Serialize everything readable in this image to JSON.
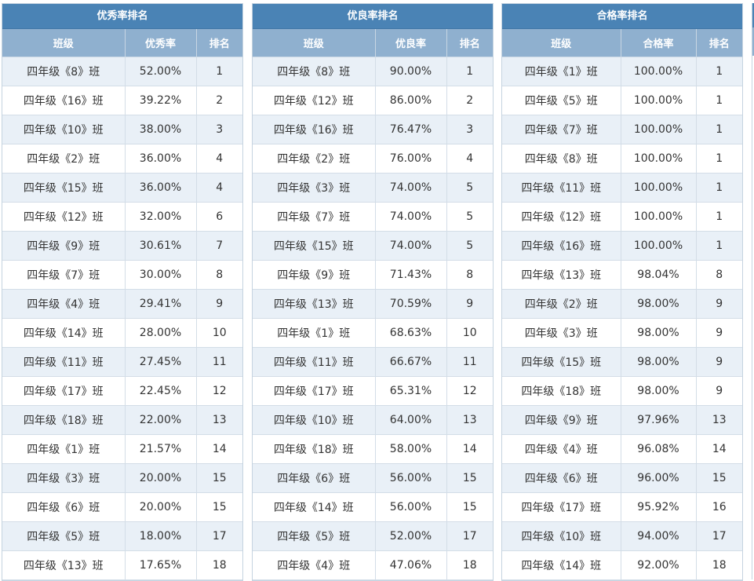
{
  "panels": [
    {
      "title": "优秀率排名",
      "headers": [
        "班级",
        "优秀率",
        "排名"
      ],
      "rows": [
        [
          "四年级《8》班",
          "52.00%",
          "1"
        ],
        [
          "四年级《16》班",
          "39.22%",
          "2"
        ],
        [
          "四年级《10》班",
          "38.00%",
          "3"
        ],
        [
          "四年级《2》班",
          "36.00%",
          "4"
        ],
        [
          "四年级《15》班",
          "36.00%",
          "4"
        ],
        [
          "四年级《12》班",
          "32.00%",
          "6"
        ],
        [
          "四年级《9》班",
          "30.61%",
          "7"
        ],
        [
          "四年级《7》班",
          "30.00%",
          "8"
        ],
        [
          "四年级《4》班",
          "29.41%",
          "9"
        ],
        [
          "四年级《14》班",
          "28.00%",
          "10"
        ],
        [
          "四年级《11》班",
          "27.45%",
          "11"
        ],
        [
          "四年级《17》班",
          "22.45%",
          "12"
        ],
        [
          "四年级《18》班",
          "22.00%",
          "13"
        ],
        [
          "四年级《1》班",
          "21.57%",
          "14"
        ],
        [
          "四年级《3》班",
          "20.00%",
          "15"
        ],
        [
          "四年级《6》班",
          "20.00%",
          "15"
        ],
        [
          "四年级《5》班",
          "18.00%",
          "17"
        ],
        [
          "四年级《13》班",
          "17.65%",
          "18"
        ]
      ]
    },
    {
      "title": "优良率排名",
      "headers": [
        "班级",
        "优良率",
        "排名"
      ],
      "rows": [
        [
          "四年级《8》班",
          "90.00%",
          "1"
        ],
        [
          "四年级《12》班",
          "86.00%",
          "2"
        ],
        [
          "四年级《16》班",
          "76.47%",
          "3"
        ],
        [
          "四年级《2》班",
          "76.00%",
          "4"
        ],
        [
          "四年级《3》班",
          "74.00%",
          "5"
        ],
        [
          "四年级《7》班",
          "74.00%",
          "5"
        ],
        [
          "四年级《15》班",
          "74.00%",
          "5"
        ],
        [
          "四年级《9》班",
          "71.43%",
          "8"
        ],
        [
          "四年级《13》班",
          "70.59%",
          "9"
        ],
        [
          "四年级《1》班",
          "68.63%",
          "10"
        ],
        [
          "四年级《11》班",
          "66.67%",
          "11"
        ],
        [
          "四年级《17》班",
          "65.31%",
          "12"
        ],
        [
          "四年级《10》班",
          "64.00%",
          "13"
        ],
        [
          "四年级《18》班",
          "58.00%",
          "14"
        ],
        [
          "四年级《6》班",
          "56.00%",
          "15"
        ],
        [
          "四年级《14》班",
          "56.00%",
          "15"
        ],
        [
          "四年级《5》班",
          "52.00%",
          "17"
        ],
        [
          "四年级《4》班",
          "47.06%",
          "18"
        ]
      ]
    },
    {
      "title": "合格率排名",
      "headers": [
        "班级",
        "合格率",
        "排名"
      ],
      "rows": [
        [
          "四年级《1》班",
          "100.00%",
          "1"
        ],
        [
          "四年级《5》班",
          "100.00%",
          "1"
        ],
        [
          "四年级《7》班",
          "100.00%",
          "1"
        ],
        [
          "四年级《8》班",
          "100.00%",
          "1"
        ],
        [
          "四年级《11》班",
          "100.00%",
          "1"
        ],
        [
          "四年级《12》班",
          "100.00%",
          "1"
        ],
        [
          "四年级《16》班",
          "100.00%",
          "1"
        ],
        [
          "四年级《13》班",
          "98.04%",
          "8"
        ],
        [
          "四年级《2》班",
          "98.00%",
          "9"
        ],
        [
          "四年级《3》班",
          "98.00%",
          "9"
        ],
        [
          "四年级《15》班",
          "98.00%",
          "9"
        ],
        [
          "四年级《18》班",
          "98.00%",
          "9"
        ],
        [
          "四年级《9》班",
          "97.96%",
          "13"
        ],
        [
          "四年级《4》班",
          "96.08%",
          "14"
        ],
        [
          "四年级《6》班",
          "96.00%",
          "15"
        ],
        [
          "四年级《17》班",
          "95.92%",
          "16"
        ],
        [
          "四年级《10》班",
          "94.00%",
          "17"
        ],
        [
          "四年级《14》班",
          "92.00%",
          "18"
        ]
      ]
    }
  ]
}
